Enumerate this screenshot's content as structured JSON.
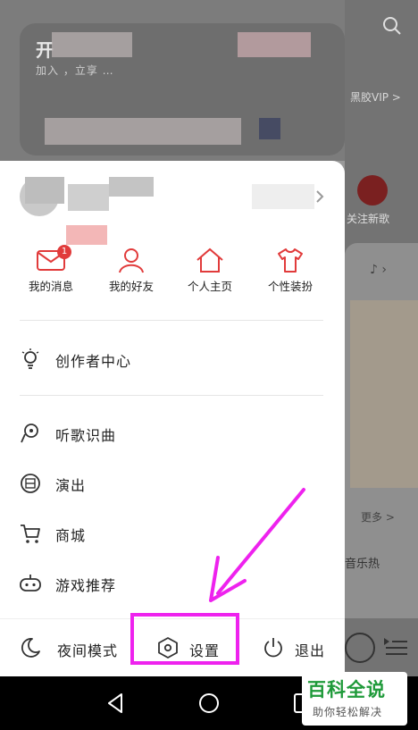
{
  "background_app": {
    "vip_title": "开",
    "vip_subtitle": "加入    ，立享 …",
    "vip_link": "黑胶VIP >",
    "new_song_label": "关注新歌",
    "more_label": "更多 >",
    "music_label": "音乐热"
  },
  "drawer": {
    "quick_actions": [
      {
        "label": "我的消息",
        "icon": "mail-icon",
        "badge": "1"
      },
      {
        "label": "我的好友",
        "icon": "friends-icon"
      },
      {
        "label": "个人主页",
        "icon": "home-icon"
      },
      {
        "label": "个性装扮",
        "icon": "tshirt-icon"
      }
    ],
    "menu": [
      {
        "label": "创作者中心",
        "icon": "lightbulb-icon"
      },
      {
        "label": "听歌识曲",
        "icon": "mic-icon"
      },
      {
        "label": "演出",
        "icon": "ticket-icon"
      },
      {
        "label": "商城",
        "icon": "cart-icon"
      },
      {
        "label": "游戏推荐",
        "icon": "gamepad-icon"
      }
    ],
    "bottom": {
      "night_mode": "夜间模式",
      "settings": "设置",
      "logout": "退出"
    }
  },
  "watermark": {
    "title": "百科全说",
    "subtitle": "助你轻松解决"
  },
  "colors": {
    "accent_red": "#e13b3b",
    "annotation_magenta": "#ee22ee",
    "watermark_green": "#1f9a3a"
  }
}
